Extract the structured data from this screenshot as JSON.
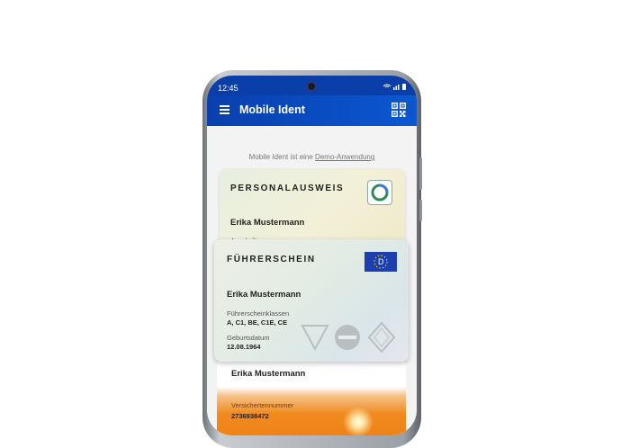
{
  "status": {
    "time": "12:45",
    "icons": "wifi-icon signal-icon battery-icon"
  },
  "appbar": {
    "title": "Mobile Ident"
  },
  "demo": {
    "prefix": "Mobile Ident ist eine ",
    "link": "Demo-Anwendung"
  },
  "cards": {
    "personalausweis": {
      "title": "PERSONALAUSWEIS",
      "name": "Erika Mustermann",
      "address_label": "Anschrift"
    },
    "fuehrerschein": {
      "title": "FÜHRERSCHEIN",
      "eu_badge": "D",
      "name": "Erika Mustermann",
      "classes_label": "Führerscheinklassen",
      "classes_value": "A, C1, BE, C1E, CE",
      "dob_label": "Geburtsdatum",
      "dob_value": "12.08.1964"
    },
    "versicherung": {
      "name": "Erika Mustermann",
      "number_label": "Versichertennummer",
      "number_value": "2736938472"
    }
  },
  "colors": {
    "appbar": "#0b4fc4",
    "eu_flag": "#1b3fb0",
    "orange": "#f08a1e"
  }
}
